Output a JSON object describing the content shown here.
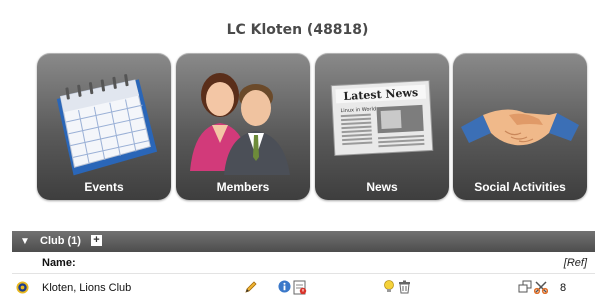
{
  "page": {
    "title": "LC Kloten (48818)"
  },
  "tiles": [
    {
      "label": "Events",
      "icon": "calendar-icon"
    },
    {
      "label": "Members",
      "icon": "people-icon"
    },
    {
      "label": "News",
      "icon": "newspaper-icon"
    },
    {
      "label": "Social Activities",
      "icon": "handshake-icon"
    }
  ],
  "news_icon_text": {
    "masthead": "Latest News",
    "column": "Linux in World"
  },
  "section": {
    "title": "Club (1)",
    "expand_symbol": "+"
  },
  "table": {
    "header_name": "Name:",
    "header_ref": "[Ref]",
    "rows": [
      {
        "name": "Kloten, Lions Club",
        "count": "8"
      }
    ]
  },
  "icons": [
    "lions-logo-icon",
    "edit-pencil-icon",
    "info-icon",
    "calendar-report-icon",
    "lightbulb-icon",
    "trash-icon",
    "window-icon",
    "scissors-icon"
  ],
  "colors": {
    "tile_top": "#8a8a8a",
    "tile_bottom": "#3e3e3e",
    "bar": "#5a5a5a",
    "title": "#4a4a4a"
  }
}
